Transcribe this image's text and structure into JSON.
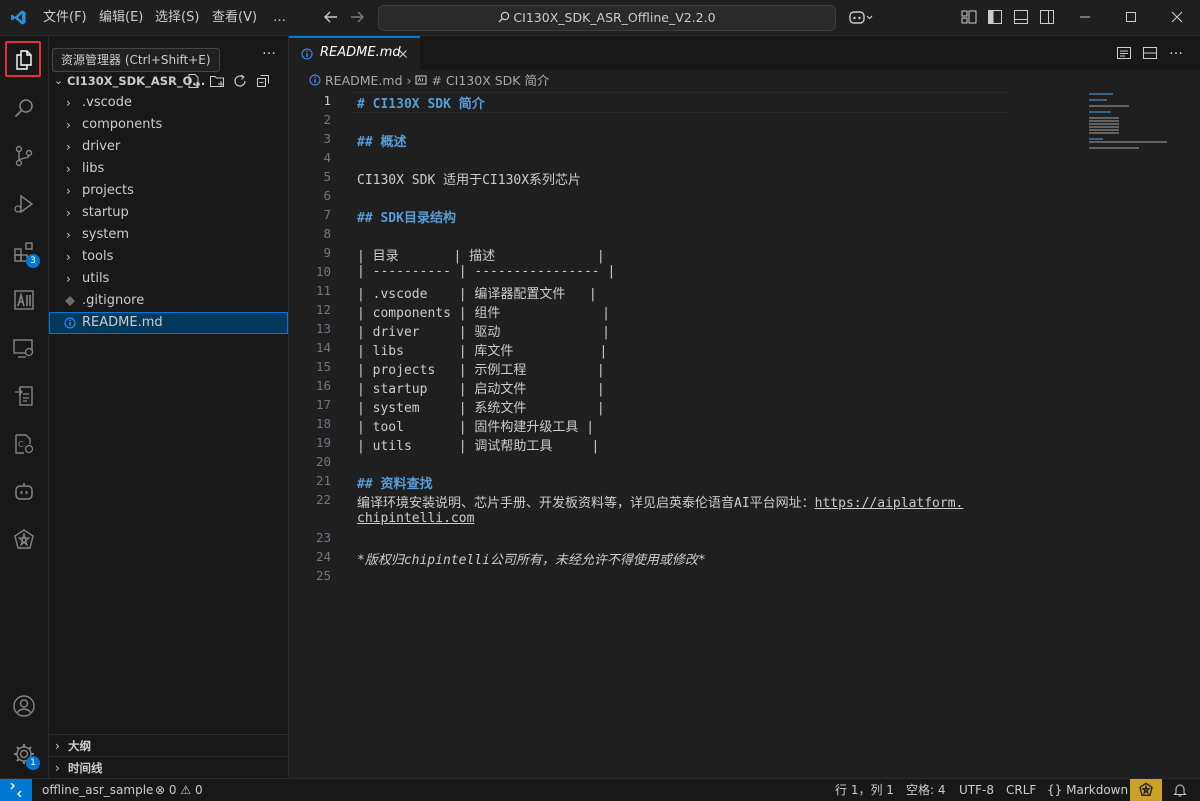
{
  "titlebar": {
    "menus": [
      "文件(F)",
      "编辑(E)",
      "选择(S)",
      "查看(V)",
      "…"
    ],
    "search_text": "CI130X_SDK_ASR_Offline_V2.2.0"
  },
  "tooltip": "资源管理器 (Ctrl+Shift+E)",
  "activity": {
    "extensions_badge": "3",
    "settings_badge": "1"
  },
  "sidebar": {
    "more": "…",
    "folder_title": "CI130X_SDK_ASR_O...",
    "items": [
      {
        "label": ".vscode",
        "type": "folder"
      },
      {
        "label": "components",
        "type": "folder"
      },
      {
        "label": "driver",
        "type": "folder"
      },
      {
        "label": "libs",
        "type": "folder"
      },
      {
        "label": "projects",
        "type": "folder"
      },
      {
        "label": "startup",
        "type": "folder"
      },
      {
        "label": "system",
        "type": "folder"
      },
      {
        "label": "tools",
        "type": "folder"
      },
      {
        "label": "utils",
        "type": "folder"
      },
      {
        "label": ".gitignore",
        "type": "file"
      },
      {
        "label": "README.md",
        "type": "file"
      }
    ],
    "outline_label": "大纲",
    "timeline_label": "时间线"
  },
  "editor": {
    "tab_label": "README.md",
    "breadcrumb_file": "README.md",
    "breadcrumb_symbol": "# CI130X SDK 简介",
    "lines": [
      {
        "n": "1",
        "text": "# CI130X SDK 简介",
        "style": "h"
      },
      {
        "n": "2",
        "text": "",
        "style": ""
      },
      {
        "n": "3",
        "text": "## 概述",
        "style": "h"
      },
      {
        "n": "4",
        "text": "",
        "style": ""
      },
      {
        "n": "5",
        "text": "CI130X SDK 适用于CI130X系列芯片",
        "style": ""
      },
      {
        "n": "6",
        "text": "",
        "style": ""
      },
      {
        "n": "7",
        "text": "## SDK目录结构",
        "style": "h"
      },
      {
        "n": "8",
        "text": "",
        "style": ""
      },
      {
        "n": "9",
        "text": "| 目录       | 描述             |",
        "style": ""
      },
      {
        "n": "10",
        "text": "| ---------- | ---------------- |",
        "style": ""
      },
      {
        "n": "11",
        "text": "| .vscode    | 编译器配置文件   |",
        "style": ""
      },
      {
        "n": "12",
        "text": "| components | 组件             |",
        "style": ""
      },
      {
        "n": "13",
        "text": "| driver     | 驱动             |",
        "style": ""
      },
      {
        "n": "14",
        "text": "| libs       | 库文件           |",
        "style": ""
      },
      {
        "n": "15",
        "text": "| projects   | 示例工程         |",
        "style": ""
      },
      {
        "n": "16",
        "text": "| startup    | 启动文件         |",
        "style": ""
      },
      {
        "n": "17",
        "text": "| system     | 系统文件         |",
        "style": ""
      },
      {
        "n": "18",
        "text": "| tool       | 固件构建升级工具 |",
        "style": ""
      },
      {
        "n": "19",
        "text": "| utils      | 调试帮助工具     |",
        "style": ""
      },
      {
        "n": "20",
        "text": "",
        "style": ""
      },
      {
        "n": "21",
        "text": "## 资料查找",
        "style": "h"
      },
      {
        "n": "22",
        "text": "编译环境安装说明、芯片手册、开发板资料等，详见启英泰伦语音AI平台网址：",
        "style": "",
        "link": "https://aiplatform.",
        "cont": "chipintelli.com"
      },
      {
        "n": "23",
        "text": "",
        "style": ""
      },
      {
        "n": "24",
        "text": "*版权归chipintelli公司所有，未经允许不得使用或修改*",
        "style": "it"
      },
      {
        "n": "25",
        "text": "",
        "style": ""
      }
    ]
  },
  "statusbar": {
    "branch": "offline_asr_sample",
    "errors": "0",
    "warnings": "0",
    "position": "行 1，列 1",
    "spaces": "空格: 4",
    "encoding": "UTF-8",
    "eol": "CRLF",
    "language": "Markdown"
  },
  "colors": {
    "accent": "#0078d4",
    "heading": "#569cd6",
    "background": "#1f1f1f"
  }
}
